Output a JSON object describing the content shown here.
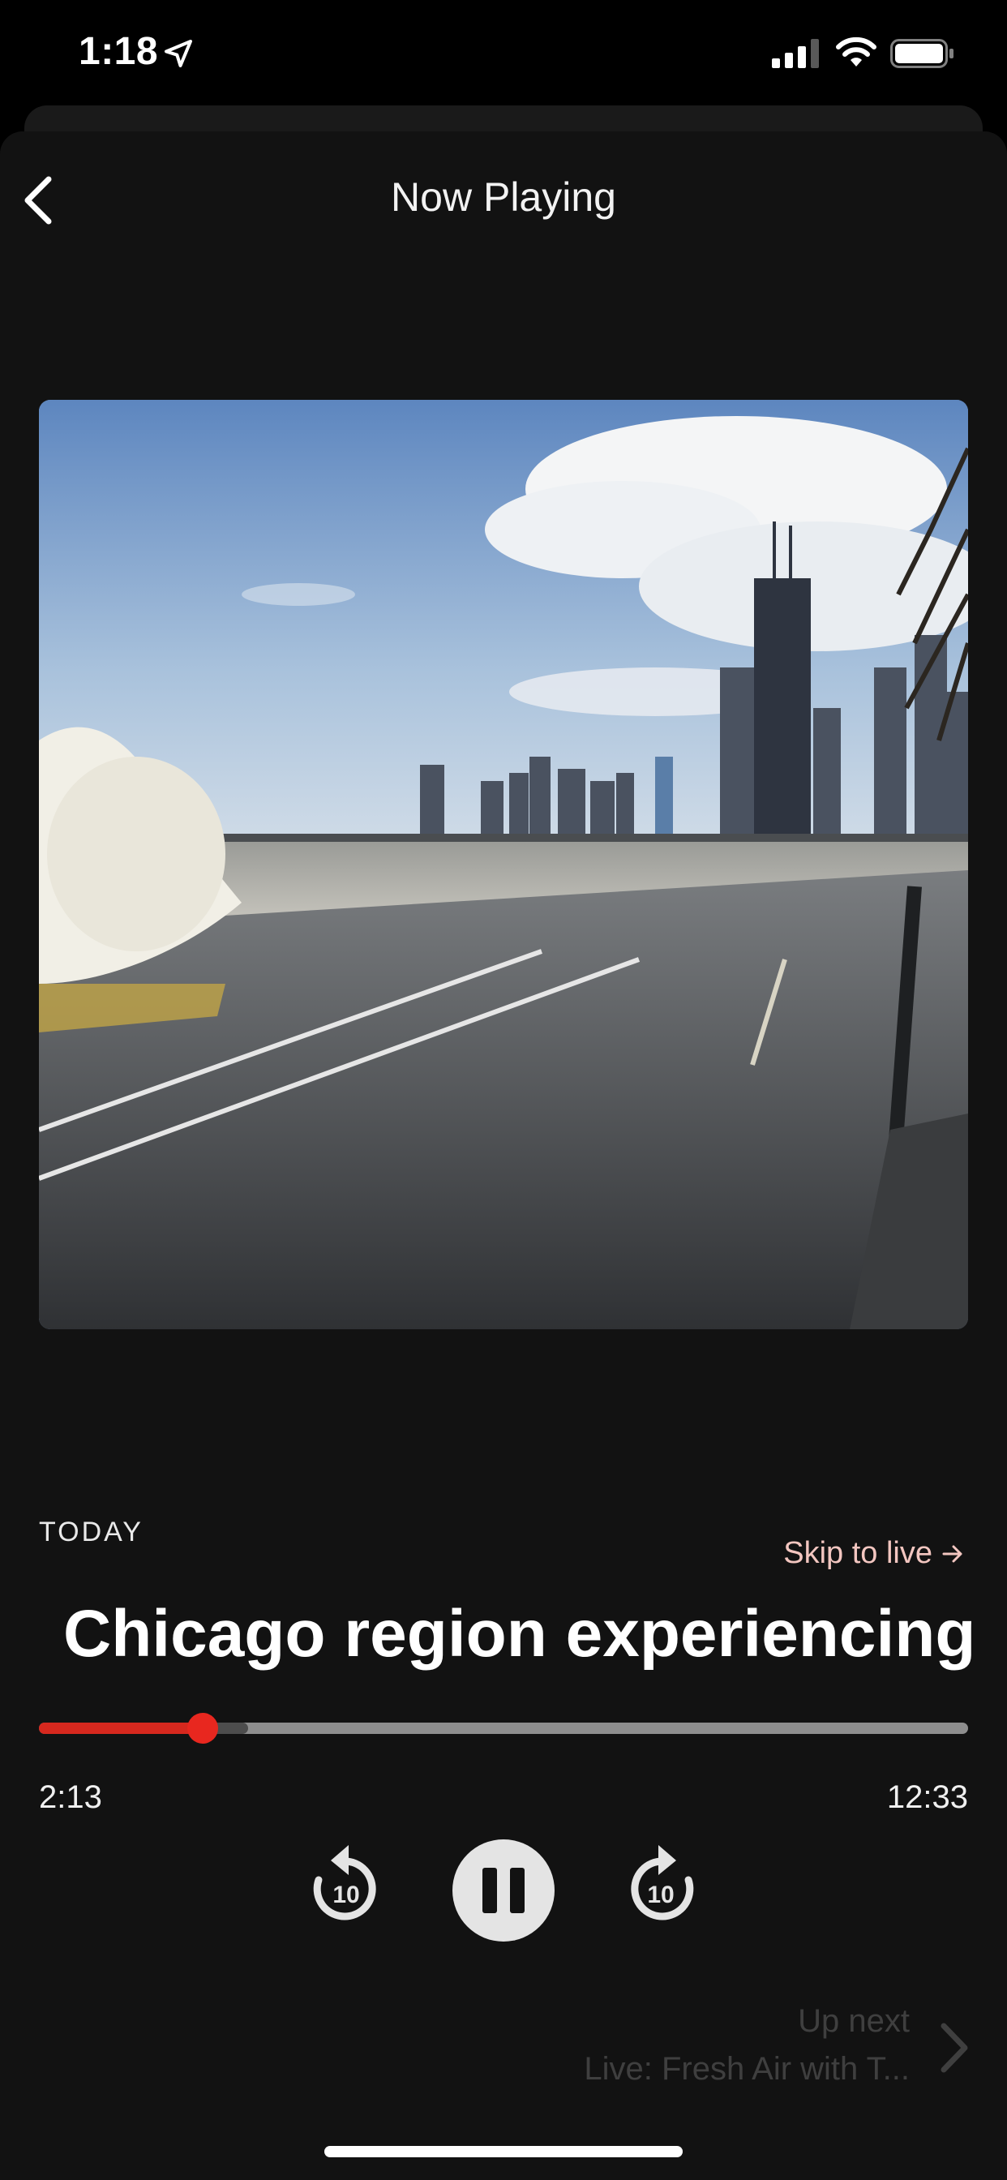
{
  "status_bar": {
    "time": "1:18",
    "icons": [
      "location-arrow-icon",
      "cellular-signal-icon",
      "wifi-icon",
      "battery-icon"
    ]
  },
  "nav": {
    "back_icon": "chevron-left-icon",
    "title": "Now Playing"
  },
  "artwork": {
    "description_icon": "episode-artwork"
  },
  "episode": {
    "date_label": "TODAY",
    "skip_to_live": "Skip to live",
    "skip_icon": "arrow-right-icon",
    "title": "Chicago region experiencing"
  },
  "playback": {
    "elapsed": "2:13",
    "remaining": "12:33",
    "progress_fraction": 0.176,
    "buffered_fraction": 0.225,
    "rewind_seconds": "10",
    "forward_seconds": "10",
    "state": "playing"
  },
  "up_next": {
    "label": "Up next",
    "title": "Live: Fresh Air with T...",
    "chevron_icon": "chevron-right-icon"
  },
  "colors": {
    "accent": "#d6281e",
    "background": "#121212",
    "skip_link": "#f3c6c0"
  }
}
